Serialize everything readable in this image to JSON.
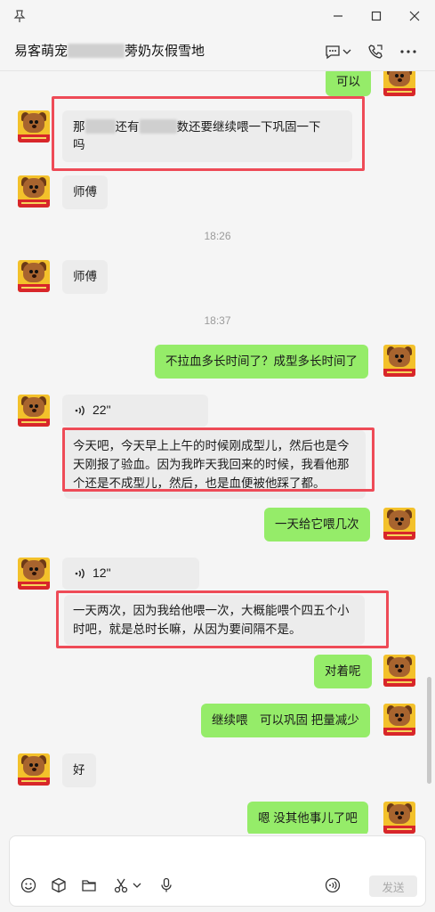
{
  "window": {
    "icons": [
      "pin-icon",
      "minimize-icon",
      "maximize-icon",
      "close-icon"
    ]
  },
  "header": {
    "title_prefix": "易客萌宠",
    "title_suffix": "蒡奶灰假雪地",
    "icons": [
      "chat-bubble-icon",
      "chevron-down-icon",
      "phone-icon",
      "more-icon"
    ]
  },
  "messages": {
    "m1": {
      "text": "可以"
    },
    "m2": {
      "text_part1": "那",
      "text_part2": "还有",
      "text_part3": "数还要继续喂一下巩固一下",
      "text_part4": "吗"
    },
    "m3": {
      "text": "师傅"
    },
    "t1": {
      "text": "18:26"
    },
    "m4": {
      "text": "师傅"
    },
    "t2": {
      "text": "18:37"
    },
    "m5": {
      "text": "不拉血多长时间了？成型多长时间了"
    },
    "m6": {
      "duration": "22\"",
      "transcript": "今天吧，今天早上上午的时候刚成型儿，然后也是今天刚报了验血。因为我昨天我回来的时候，我看他那个还是不成型儿，然后，也是血便被他踩了都。"
    },
    "m7": {
      "text": "一天给它喂几次"
    },
    "m8": {
      "duration": "12\"",
      "transcript": "一天两次，因为我给他喂一次，大概能喂个四五个小时吧，就是总时长嘛，从因为要间隔不是。"
    },
    "m9": {
      "text": "对着呢"
    },
    "m10": {
      "text": "继续喂　可以巩固 把量减少"
    },
    "m11": {
      "text": "好"
    },
    "m12": {
      "text": "嗯 没其他事儿了吧"
    }
  },
  "toolbar": {
    "icons": [
      "emoji-icon",
      "cube-icon",
      "folder-icon",
      "scissors-icon",
      "chevron-down-icon",
      "microphone-icon",
      "voice-input-icon"
    ],
    "send_label": "发送"
  },
  "colors": {
    "outgoing_bubble": "#95ec69",
    "incoming_bubble": "#ffffff",
    "annotation_box": "#ee4b57",
    "background": "#f5f5f5"
  }
}
